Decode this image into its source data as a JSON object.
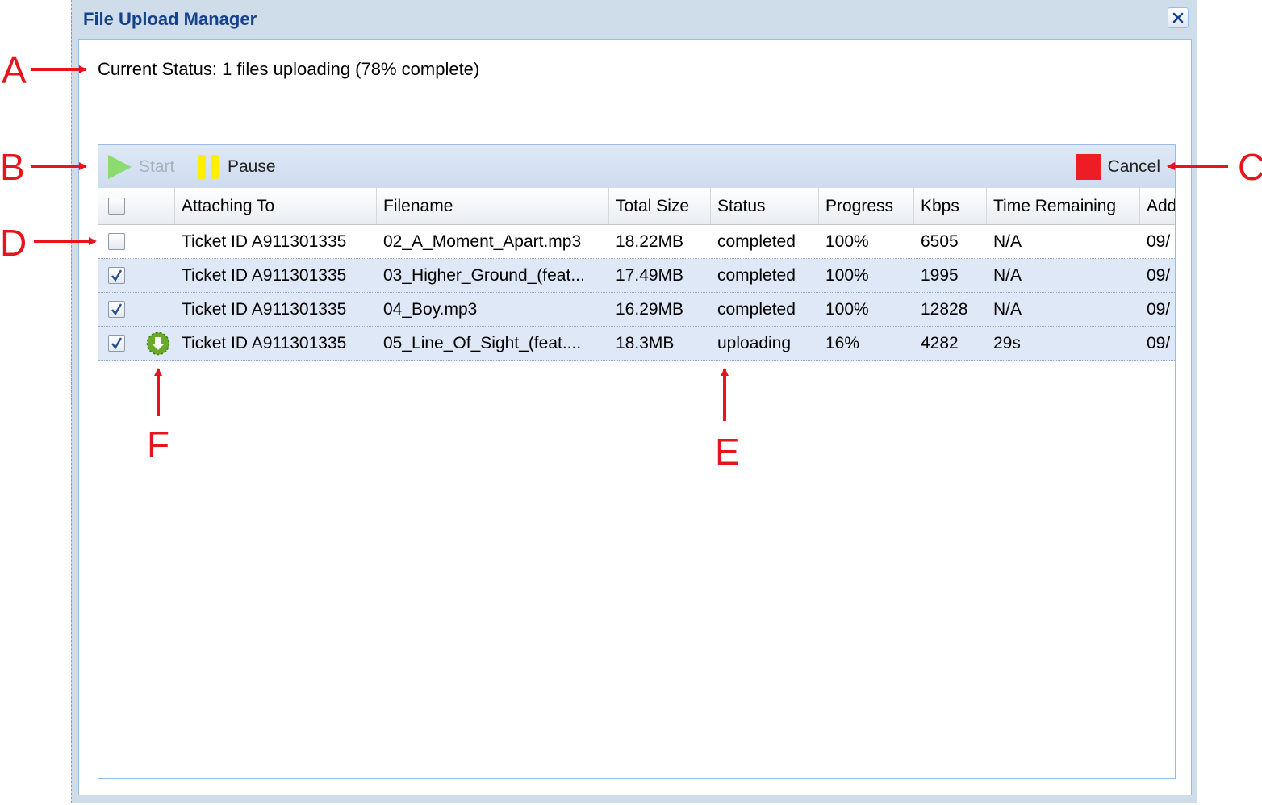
{
  "window": {
    "title": "File Upload Manager",
    "close_icon": "close-icon"
  },
  "status": {
    "text": "Current Status: 1 files uploading (78% complete)"
  },
  "toolbar": {
    "start_label": "Start",
    "pause_label": "Pause",
    "cancel_label": "Cancel",
    "start_icon": "play-icon",
    "pause_icon": "pause-icon",
    "cancel_icon": "stop-icon",
    "colors": {
      "start": "#7ed957",
      "pause": "#ffee00",
      "cancel": "#ee1c25"
    }
  },
  "grid": {
    "columns": [
      "",
      "",
      "Attaching To",
      "Filename",
      "Total Size",
      "Status",
      "Progress",
      "Kbps",
      "Time Remaining",
      "Add"
    ],
    "rows": [
      {
        "checked": false,
        "icon": "",
        "attaching_to": "Ticket ID A911301335",
        "filename": "02_A_Moment_Apart.mp3",
        "total_size": "18.22MB",
        "status": "completed",
        "progress": "100%",
        "kbps": "6505",
        "time_remaining": "N/A",
        "added": "09/"
      },
      {
        "checked": true,
        "icon": "",
        "attaching_to": "Ticket ID A911301335",
        "filename": "03_Higher_Ground_(feat...",
        "total_size": "17.49MB",
        "status": "completed",
        "progress": "100%",
        "kbps": "1995",
        "time_remaining": "N/A",
        "added": "09/"
      },
      {
        "checked": true,
        "icon": "",
        "attaching_to": "Ticket ID A911301335",
        "filename": "04_Boy.mp3",
        "total_size": "16.29MB",
        "status": "completed",
        "progress": "100%",
        "kbps": "12828",
        "time_remaining": "N/A",
        "added": "09/"
      },
      {
        "checked": true,
        "icon": "upload-in-progress-icon",
        "attaching_to": "Ticket ID A911301335",
        "filename": "05_Line_Of_Sight_(feat....",
        "total_size": "18.3MB",
        "status": "uploading",
        "progress": "16%",
        "kbps": "4282",
        "time_remaining": "29s",
        "added": "09/"
      }
    ]
  },
  "annotations": [
    "A",
    "B",
    "C",
    "D",
    "E",
    "F"
  ],
  "colors": {
    "title_text": "#15428b",
    "window_frame": "#cfdcea",
    "panel_border": "#99bbe8",
    "selected_row": "#dfe8f6",
    "annotation": "#e8141b",
    "upload_icon": "#6aaa2a"
  }
}
